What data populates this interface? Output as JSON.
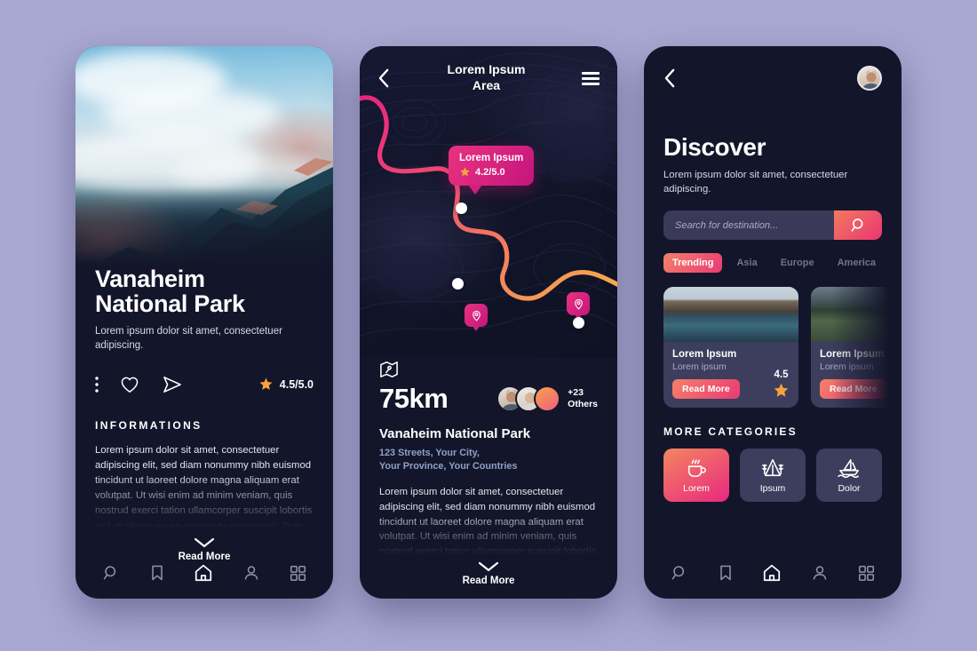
{
  "background_color": "#a9a8d2",
  "accent": {
    "pink": "#ea3572",
    "magenta": "#c4157d",
    "orange": "#f4806a",
    "star": "#f5a43c"
  },
  "phone1": {
    "title_line1": "Vanaheim",
    "title_line2": "National Park",
    "subtitle": "Lorem ipsum dolor sit amet, consectetuer adipiscing.",
    "rating": "4.5/5.0",
    "actions": {
      "more": "more-options",
      "like": "heart",
      "share": "send"
    },
    "section_title": "INFORMATIONS",
    "body": "Lorem ipsum dolor sit amet, consectetuer adipiscing elit, sed diam nonummy nibh euismod tincidunt ut laoreet dolore magna aliquam erat volutpat. Ut wisi enim ad minim veniam, quis nostrud exerci tation ullamcorper suscipit lobortis nisl ut aliquip ex ea commodo consequat. Duis autem vel eum iriure.",
    "read_more": "Read More",
    "nav": [
      {
        "name": "search",
        "active": false
      },
      {
        "name": "bookmark",
        "active": false
      },
      {
        "name": "home",
        "active": true
      },
      {
        "name": "profile",
        "active": false
      },
      {
        "name": "grid",
        "active": false
      }
    ]
  },
  "phone2": {
    "header_title": "Lorem Ipsum\nArea",
    "header_title_l1": "Lorem Ipsum",
    "header_title_l2": "Area",
    "tooltip": {
      "title": "Lorem Ipsum",
      "rating": "4.2/5.0"
    },
    "distance": "75km",
    "others_l1": "+23",
    "others_l2": "Others",
    "park_name": "Vanaheim National Park",
    "address_l1": "123 Streets, Your City,",
    "address_l2": "Your Province, Your Countries",
    "body": "Lorem ipsum dolor sit amet, consectetuer adipiscing elit, sed diam nonummy nibh euismod tincidunt ut laoreet dolore magna aliquam erat volutpat. Ut wisi enim ad minim veniam, quis nostrud exerci tation ullamcorper suscipit lobortis nisl ut aliquip.",
    "read_more": "Read More"
  },
  "phone3": {
    "heading": "Discover",
    "subtitle": "Lorem ipsum dolor sit amet, consectetuer adipiscing.",
    "search_placeholder": "Search for destination...",
    "search_value": "",
    "tabs": [
      {
        "label": "Trending",
        "active": true
      },
      {
        "label": "Asia",
        "active": false
      },
      {
        "label": "Europe",
        "active": false
      },
      {
        "label": "America",
        "active": false
      }
    ],
    "cards": [
      {
        "title": "Lorem Ipsum",
        "subtitle": "Lorem ipsum",
        "button": "Read More",
        "rating": "4.5"
      },
      {
        "title": "Lorem Ipsum",
        "subtitle": "Lorem ipsum",
        "button": "Read More",
        "rating": ""
      }
    ],
    "categories_title": "MORE CATEGORIES",
    "categories": [
      {
        "label": "Lorem",
        "icon": "coffee-cup-icon",
        "active": true
      },
      {
        "label": "Ipsum",
        "icon": "tent-icon",
        "active": false
      },
      {
        "label": "Dolor",
        "icon": "sailboat-icon",
        "active": false
      }
    ],
    "nav": [
      {
        "name": "search",
        "active": false
      },
      {
        "name": "bookmark",
        "active": false
      },
      {
        "name": "home",
        "active": true
      },
      {
        "name": "profile",
        "active": false
      },
      {
        "name": "grid",
        "active": false
      }
    ]
  }
}
